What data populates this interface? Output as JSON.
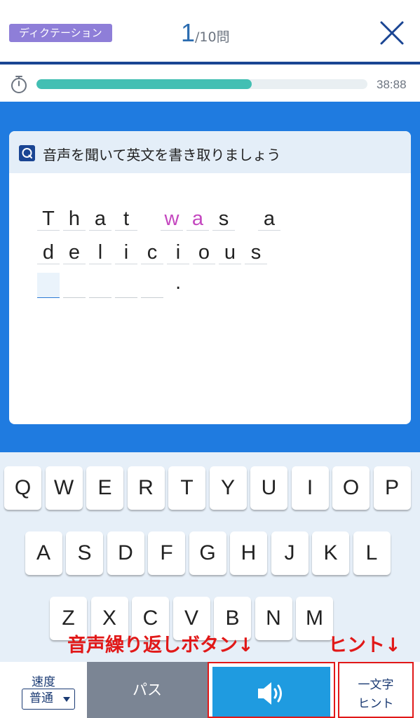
{
  "header": {
    "mode_label": "ディクテーション",
    "current_question": "1",
    "total_label": "/10問"
  },
  "timer": {
    "progress": 0.65,
    "time_text": "38:88"
  },
  "card": {
    "title": "音声を聞いて英文を書き取りましょう"
  },
  "answer": {
    "lines": [
      [
        {
          "word": [
            {
              "ch": "T"
            },
            {
              "ch": "h"
            },
            {
              "ch": "a"
            },
            {
              "ch": "t"
            }
          ]
        },
        {
          "word": [
            {
              "ch": "w",
              "hint": true
            },
            {
              "ch": "a",
              "hint": true
            },
            {
              "ch": "s"
            }
          ]
        },
        {
          "word": [
            {
              "ch": "a"
            }
          ]
        }
      ],
      [
        {
          "word": [
            {
              "ch": "d"
            },
            {
              "ch": "e"
            },
            {
              "ch": "l"
            },
            {
              "ch": "i"
            },
            {
              "ch": "c"
            },
            {
              "ch": "i"
            },
            {
              "ch": "o"
            },
            {
              "ch": "u"
            },
            {
              "ch": "s"
            }
          ]
        }
      ]
    ],
    "blank_count": 5,
    "period": "."
  },
  "keyboard": {
    "rows": [
      [
        "Q",
        "W",
        "E",
        "R",
        "T",
        "Y",
        "U",
        "I",
        "O",
        "P"
      ],
      [
        "A",
        "S",
        "D",
        "F",
        "G",
        "H",
        "J",
        "K",
        "L"
      ],
      [
        "Z",
        "X",
        "C",
        "V",
        "B",
        "N",
        "M"
      ]
    ]
  },
  "annotations": {
    "repeat_button": "音声繰り返しボタン↓",
    "hint": "ヒント↓"
  },
  "bottom": {
    "speed_label": "速度",
    "speed_value": "普通",
    "pass_label": "パス",
    "hint_line1": "一文字",
    "hint_line2": "ヒント"
  },
  "colors": {
    "header_accent": "#1a4593",
    "progress": "#43bfb3",
    "main_blue": "#1f7be0",
    "hint_letter": "#c447bf",
    "annotation_red": "#e11818",
    "sound_button": "#1f9be0",
    "pass_button": "#7b8594"
  },
  "icons": {
    "close": "close-icon",
    "timer": "stopwatch-icon",
    "question": "question-icon",
    "sound": "speaker-icon"
  }
}
